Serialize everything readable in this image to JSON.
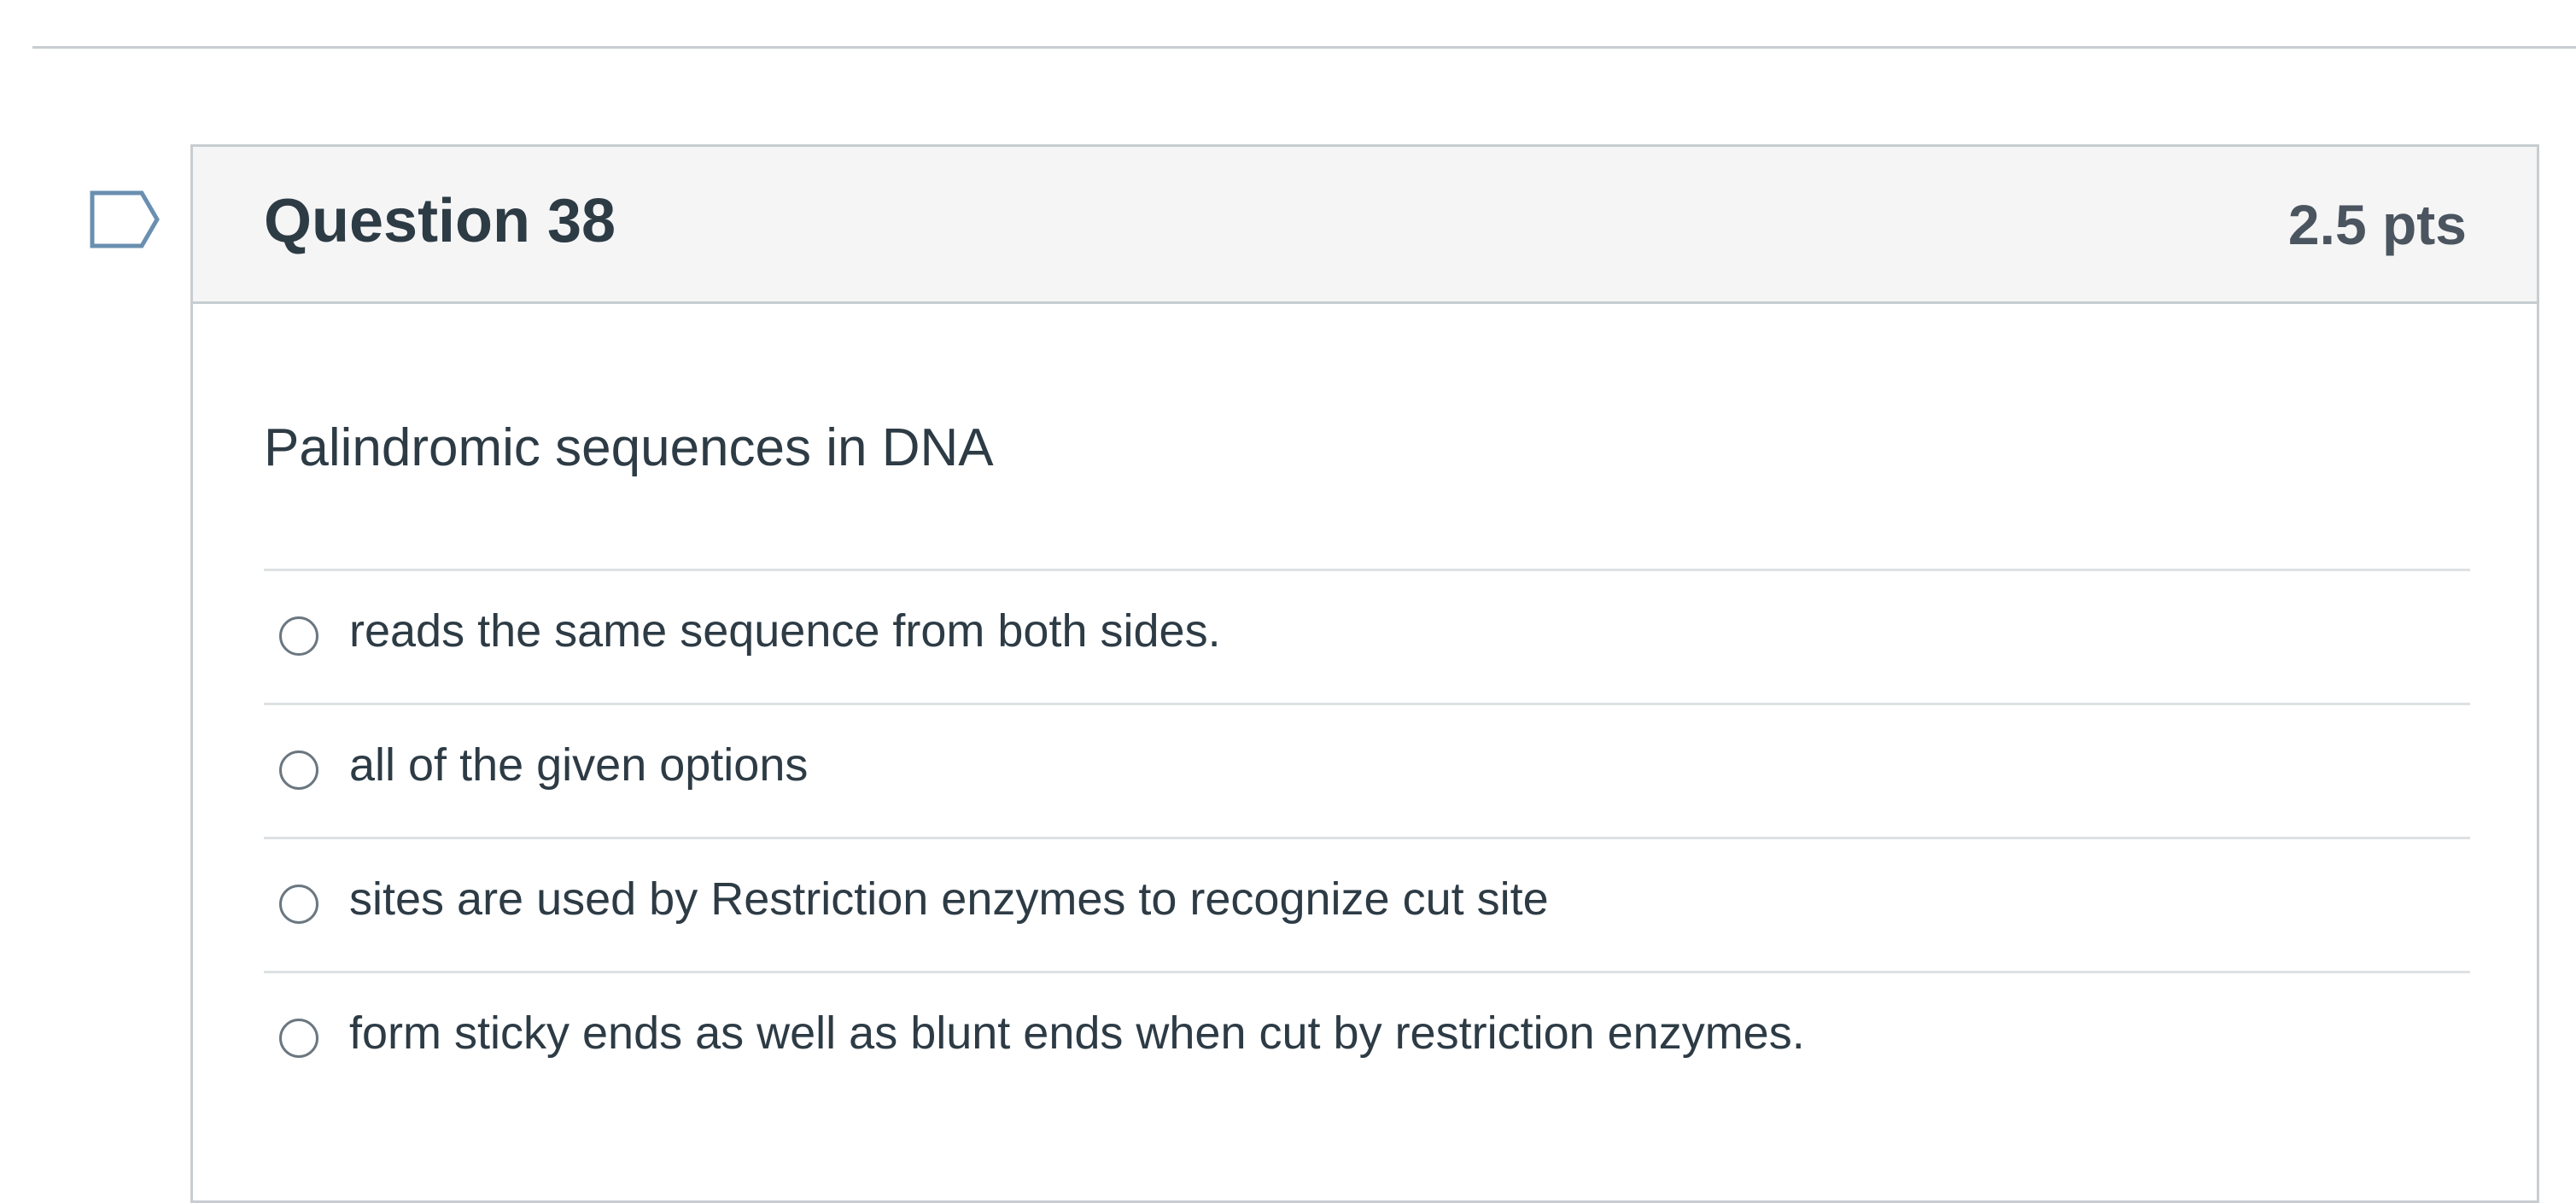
{
  "question": {
    "title": "Question 38",
    "points": "2.5 pts",
    "text": "Palindromic sequences in DNA",
    "flag_icon": "bookmark-flag-icon",
    "answers": [
      {
        "label": "reads the same sequence from both sides.",
        "selected": false
      },
      {
        "label": "all of the given options",
        "selected": false
      },
      {
        "label": "sites are used by Restriction enzymes to recognize cut site",
        "selected": false
      },
      {
        "label": "form sticky ends as well as blunt ends when cut by restriction enzymes.",
        "selected": false
      }
    ]
  },
  "colors": {
    "text": "#2d3b45",
    "header_background": "#f5f5f5",
    "border": "#c7cdd1",
    "flag_outline": "#6a8fb0"
  }
}
